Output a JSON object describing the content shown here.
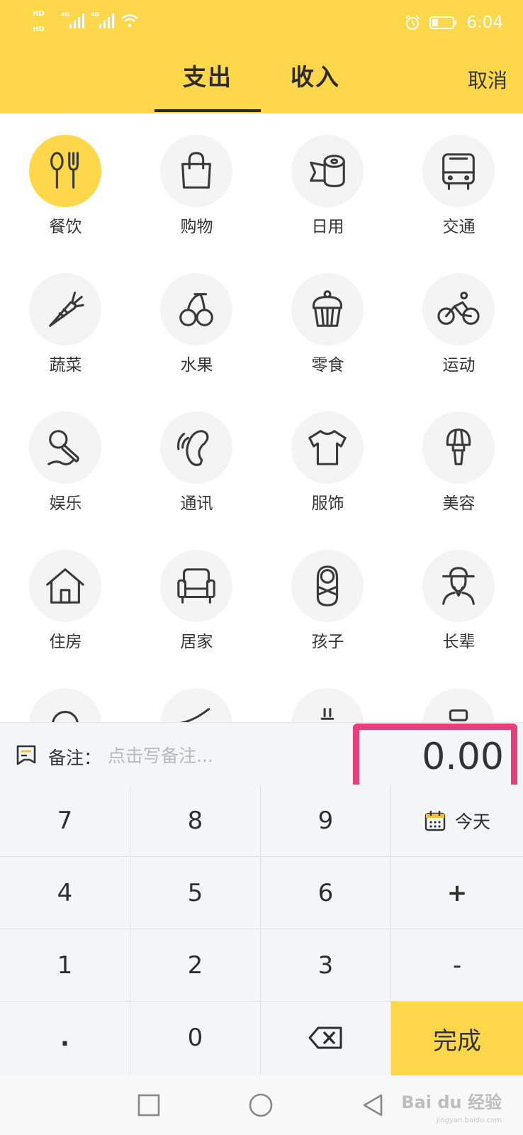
{
  "status_bar": {
    "sim1": "HD",
    "sim2": "HD",
    "net1": "4G",
    "net2": "4G",
    "time": "6:04",
    "colors": {
      "icons": "#ffffff"
    }
  },
  "header": {
    "tabs": [
      {
        "label": "支出",
        "active": true
      },
      {
        "label": "收入",
        "active": false
      }
    ],
    "cancel_label": "取消",
    "background": "#FED84A"
  },
  "categories": [
    {
      "label": "餐饮",
      "icon": "utensils-icon",
      "selected": true
    },
    {
      "label": "购物",
      "icon": "shopping-bag-icon",
      "selected": false
    },
    {
      "label": "日用",
      "icon": "tissue-roll-icon",
      "selected": false
    },
    {
      "label": "交通",
      "icon": "bus-icon",
      "selected": false
    },
    {
      "label": "蔬菜",
      "icon": "carrot-icon",
      "selected": false
    },
    {
      "label": "水果",
      "icon": "cherry-icon",
      "selected": false
    },
    {
      "label": "零食",
      "icon": "cupcake-icon",
      "selected": false
    },
    {
      "label": "运动",
      "icon": "bicycle-icon",
      "selected": false
    },
    {
      "label": "娱乐",
      "icon": "microphone-icon",
      "selected": false
    },
    {
      "label": "通讯",
      "icon": "phone-icon",
      "selected": false
    },
    {
      "label": "服饰",
      "icon": "tshirt-icon",
      "selected": false
    },
    {
      "label": "美容",
      "icon": "makeup-brush-icon",
      "selected": false
    },
    {
      "label": "住房",
      "icon": "house-icon",
      "selected": false
    },
    {
      "label": "居家",
      "icon": "armchair-icon",
      "selected": false
    },
    {
      "label": "孩子",
      "icon": "baby-icon",
      "selected": false
    },
    {
      "label": "长辈",
      "icon": "elder-icon",
      "selected": false
    }
  ],
  "note": {
    "label": "备注：",
    "placeholder": "点击写备注..."
  },
  "amount": {
    "value": "0.00",
    "highlight_color": "#E5407A"
  },
  "keypad": {
    "keys": [
      "7",
      "8",
      "9",
      "今天",
      "4",
      "5",
      "6",
      "+",
      "1",
      "2",
      "3",
      "-",
      ".",
      "0",
      "backspace",
      "完成"
    ],
    "today_label": "今天",
    "done_label": "完成"
  },
  "watermark": {
    "text": "Bai du 经验",
    "sub": "jingyan.baidu.com"
  }
}
